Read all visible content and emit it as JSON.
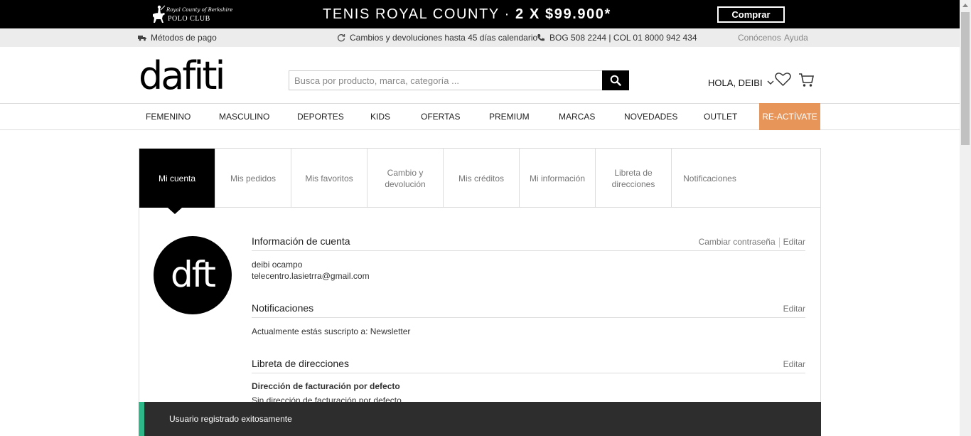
{
  "promo": {
    "brand_script": "Royal County of Berkshire",
    "brand_club": "POLO CLUB",
    "headline": "TENIS ROYAL COUNTY · ",
    "headline_strong": "2 X $99.900*",
    "cta": "Comprar"
  },
  "infobar": {
    "payment": "Métodos de pago",
    "returns": "Cambios y devoluciones hasta 45 días calendario",
    "phones": "BOG 508 2244 | COL 01 8000 942 434",
    "about": "Conócenos",
    "help": "Ayuda"
  },
  "header": {
    "logo": "dafiti",
    "search_placeholder": "Busca por producto, marca, categoría ...",
    "greeting": "HOLA, DEIBI"
  },
  "nav": {
    "items": [
      "FEMENINO",
      "MASCULINO",
      "DEPORTES",
      "KIDS",
      "OFERTAS",
      "PREMIUM",
      "MARCAS",
      "NOVEDADES",
      "OUTLET"
    ],
    "highlight": "RE-ACTÍVATE",
    "highlight_color": "#e8955a"
  },
  "tabs": [
    {
      "label": "Mi cuenta",
      "active": true
    },
    {
      "label": "Mis pedidos"
    },
    {
      "label": "Mis favoritos"
    },
    {
      "label": "Cambio y devolución"
    },
    {
      "label": "Mis créditos"
    },
    {
      "label": "Mi información"
    },
    {
      "label": "Libreta de direcciones"
    },
    {
      "label": "Notificaciones"
    }
  ],
  "avatar_text": "dft",
  "account": {
    "title": "Información de cuenta",
    "change_password": "Cambiar contraseña",
    "edit": "Editar",
    "name": "deibi ocampo",
    "email": "telecentro.lasietrra@gmail.com"
  },
  "notifications": {
    "title": "Notificaciones",
    "edit": "Editar",
    "text": "Actualmente estás suscripto a: Newsletter"
  },
  "addresses": {
    "title": "Libreta de direcciones",
    "edit": "Editar",
    "billing_title": "Dirección de facturación por defecto",
    "billing_text": "Sin dirección de facturación por defecto"
  },
  "toast": {
    "message": "Usuario registrado exitosamente",
    "accent": "#2eb88a"
  }
}
